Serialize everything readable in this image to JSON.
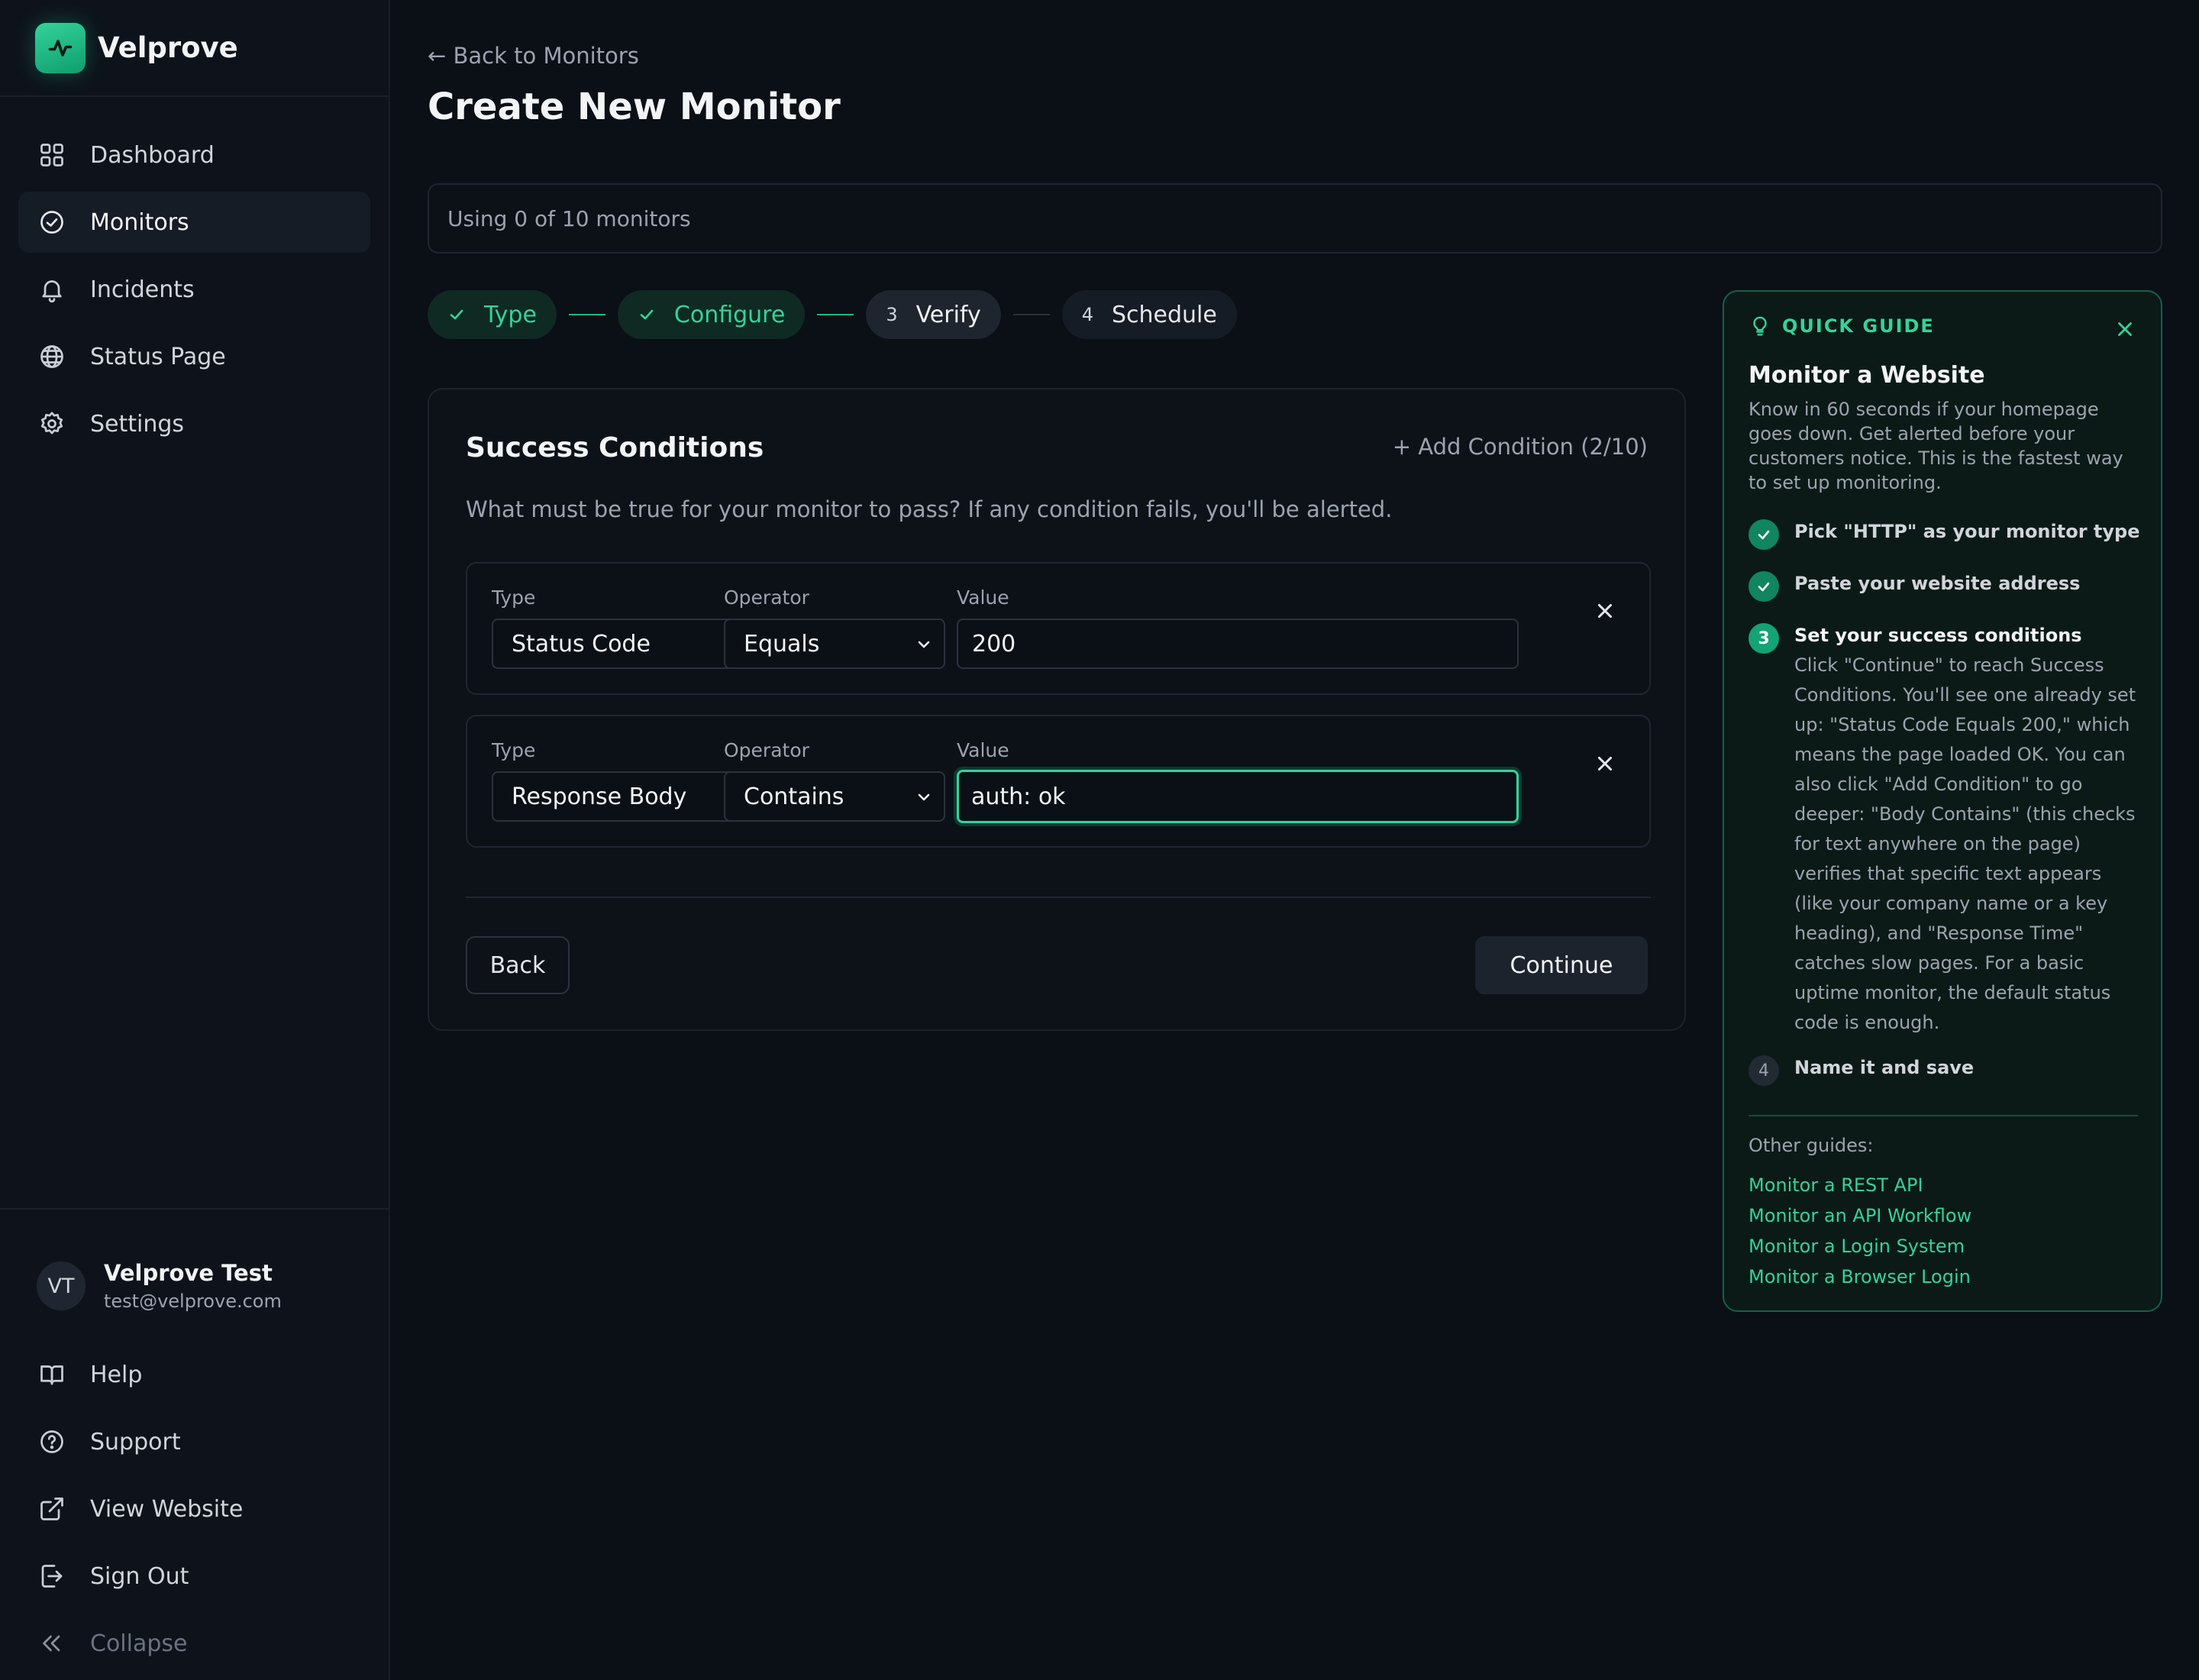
{
  "brand": {
    "name": "Velprove"
  },
  "sidebar": {
    "items": [
      {
        "label": "Dashboard",
        "icon": "grid-icon"
      },
      {
        "label": "Monitors",
        "icon": "check-circle-icon",
        "active": true
      },
      {
        "label": "Incidents",
        "icon": "bell-icon"
      },
      {
        "label": "Status Page",
        "icon": "globe-icon"
      },
      {
        "label": "Settings",
        "icon": "gear-icon"
      }
    ],
    "user": {
      "initials": "VT",
      "name": "Velprove Test",
      "email": "test@velprove.com"
    },
    "bottom_items": [
      {
        "label": "Help",
        "icon": "book-icon"
      },
      {
        "label": "Support",
        "icon": "help-circle-icon"
      },
      {
        "label": "View Website",
        "icon": "external-link-icon"
      },
      {
        "label": "Sign Out",
        "icon": "sign-out-icon"
      },
      {
        "label": "Collapse",
        "icon": "chevrons-left-icon"
      }
    ]
  },
  "header": {
    "back_link": "← Back to Monitors",
    "title": "Create New Monitor"
  },
  "usage": {
    "text": "Using 0 of 10 monitors"
  },
  "stepper": {
    "steps": [
      {
        "label": "Type",
        "state": "done"
      },
      {
        "label": "Configure",
        "state": "done"
      },
      {
        "number": "3",
        "label": "Verify",
        "state": "current"
      },
      {
        "number": "4",
        "label": "Schedule",
        "state": "upcoming"
      }
    ]
  },
  "conditions": {
    "title": "Success Conditions",
    "add_label": "+ Add Condition (2/10)",
    "description": "What must be true for your monitor to pass? If any condition fails, you'll be alerted.",
    "labels": {
      "type": "Type",
      "operator": "Operator",
      "value": "Value"
    },
    "rows": [
      {
        "type": "Status Code",
        "operator": "Equals",
        "value": "200"
      },
      {
        "type": "Response Body",
        "operator": "Contains",
        "value": "auth: ok"
      }
    ],
    "back_label": "Back",
    "continue_label": "Continue"
  },
  "guide": {
    "header": "QUICK GUIDE",
    "title": "Monitor a Website",
    "description": "Know in 60 seconds if your homepage goes down. Get alerted before your customers notice. This is the fastest way to set up monitoring.",
    "steps": [
      {
        "title": "Pick \"HTTP\" as your monitor type",
        "state": "done"
      },
      {
        "title": "Paste your website address",
        "state": "done"
      },
      {
        "number": "3",
        "title": "Set your success conditions",
        "state": "active",
        "body": "Click \"Continue\" to reach Success Conditions. You'll see one already set up: \"Status Code Equals 200,\" which means the page loaded OK. You can also click \"Add Condition\" to go deeper: \"Body Contains\" (this checks for text anywhere on the page) verifies that specific text appears (like your company name or a key heading), and \"Response Time\" catches slow pages. For a basic uptime monitor, the default status code is enough."
      },
      {
        "number": "4",
        "title": "Name it and save",
        "state": "todo"
      }
    ],
    "other_label": "Other guides:",
    "links": [
      "Monitor a REST API",
      "Monitor an API Workflow",
      "Monitor a Login System",
      "Monitor a Browser Login"
    ]
  },
  "colors": {
    "accent": "#34d399",
    "background": "#0b0f16",
    "sidebar": "#0e131b"
  }
}
